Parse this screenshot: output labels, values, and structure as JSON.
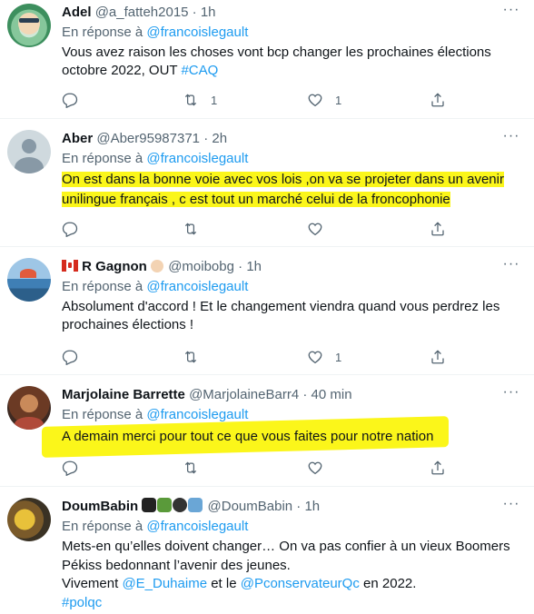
{
  "reply_prefix": "En réponse à",
  "tweets": [
    {
      "name": "Adel",
      "handle": "@a_fatteh2015",
      "sep": "·",
      "time": "1h",
      "reply_to": "@francoislegault",
      "text_a": "Vous avez raison les choses vont bcp changer les prochaines élections octobre 2022, OUT ",
      "hashtag": "#CAQ",
      "counts": {
        "reply": "",
        "retweet": "1",
        "like": "1"
      }
    },
    {
      "name": "Aber",
      "handle": "@Aber95987371",
      "sep": "·",
      "time": "2h",
      "reply_to": "@francoislegault",
      "text_line1": "On est dans la bonne voie avec vos lois ,on va se projeter dans un avenir",
      "text_line2": "unilingue français , c est tout un marché celui de la froncophonie",
      "counts": {
        "reply": "",
        "retweet": "",
        "like": ""
      }
    },
    {
      "name": "R Gagnon",
      "handle": "@moibobg",
      "sep": "·",
      "time": "1h",
      "reply_to": "@francoislegault",
      "text": "Absolument d'accord !  Et le changement viendra quand vous perdrez les prochaines élections !",
      "counts": {
        "reply": "",
        "retweet": "",
        "like": "1"
      }
    },
    {
      "name": "Marjolaine Barrette",
      "handle": "@MarjolaineBarr4",
      "sep": "·",
      "time": "40 min",
      "reply_to": "@francoislegault",
      "text": "A demain merci pour tout ce que vous faites pour notre nation",
      "counts": {
        "reply": "",
        "retweet": "",
        "like": ""
      }
    },
    {
      "name": "DoumBabin",
      "handle": "@DoumBabin",
      "sep": "·",
      "time": "1h",
      "reply_to": "@francoislegault",
      "text_line1": "Mets-en qu’elles doivent changer… On va pas confier à un vieux Boomers",
      "text_line2": "Pékiss bedonnant l’avenir des jeunes.",
      "text_line3a": "Vivement ",
      "mention1": "@E_Duhaime",
      "text_line3b": " et le ",
      "mention2": "@PconservateurQc",
      "text_line3c": " en 2022.",
      "hashtag": "#polqc"
    }
  ],
  "more_label": "···",
  "colors": {
    "link": "#1d9bf0",
    "meta": "#536471",
    "highlight": "#fbf61a"
  },
  "icons": [
    "reply-icon",
    "retweet-icon",
    "like-icon",
    "share-icon",
    "more-icon"
  ]
}
